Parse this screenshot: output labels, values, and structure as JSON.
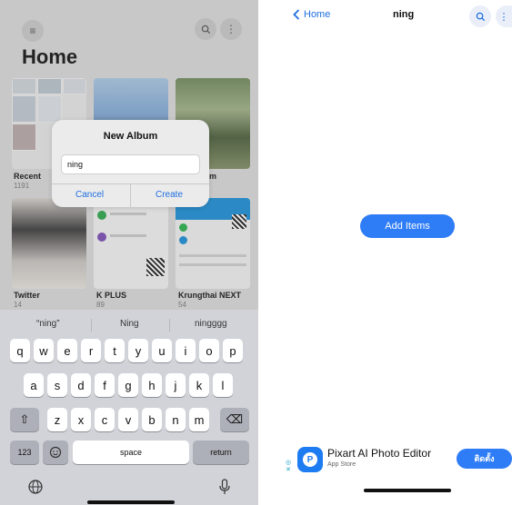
{
  "left": {
    "title": "Home",
    "albums": [
      {
        "label": "Recent",
        "count": "1191"
      },
      {
        "label": "Twitter",
        "count": "14"
      },
      {
        "label": "K PLUS",
        "count": "89"
      },
      {
        "label": "Krungthai NEXT",
        "count": "54"
      }
    ],
    "partial_label": "m",
    "dialog": {
      "title": "New Album",
      "input_value": "ning",
      "cancel": "Cancel",
      "create": "Create"
    },
    "keyboard": {
      "suggestions": [
        "“ning”",
        "Ning",
        "ningggg"
      ],
      "row1": [
        "q",
        "w",
        "e",
        "r",
        "t",
        "y",
        "u",
        "i",
        "o",
        "p"
      ],
      "row2": [
        "a",
        "s",
        "d",
        "f",
        "g",
        "h",
        "j",
        "k",
        "l"
      ],
      "row3": [
        "z",
        "x",
        "c",
        "v",
        "b",
        "n",
        "m"
      ],
      "numbers": "123",
      "space": "space",
      "return": "return"
    }
  },
  "right": {
    "back": "Home",
    "title": "ning",
    "add_items": "Add Items",
    "ad": {
      "title": "Pixart AI Photo Editor",
      "subtitle": "App Store",
      "install": "ติดตั้ง"
    }
  }
}
